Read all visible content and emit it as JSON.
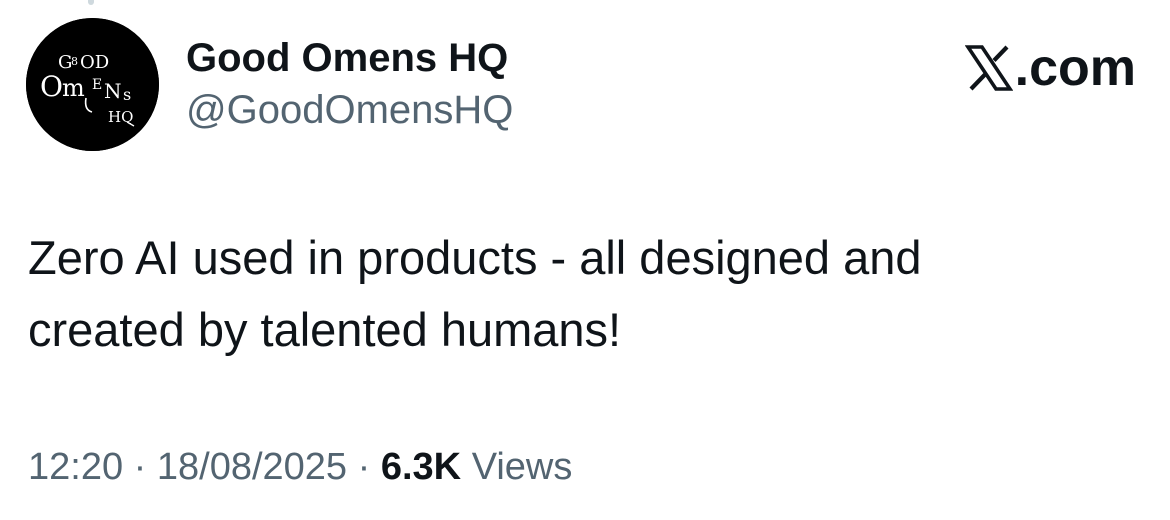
{
  "account": {
    "display_name": "Good Omens HQ",
    "handle": "@GoodOmensHQ",
    "avatar_logo_text": "GOOD OMENS HQ"
  },
  "brand": {
    "label": ".com",
    "icon": "x-logo-icon"
  },
  "tweet": {
    "text_line1": "Zero AI used in products - all designed and",
    "text_line2": "created by talented humans!"
  },
  "meta": {
    "time": "12:20",
    "separator": "·",
    "date": "18/08/2025",
    "views_count": "6.3K",
    "views_label": "Views"
  },
  "colors": {
    "text_primary": "#0f1419",
    "text_secondary": "#536471",
    "avatar_bg": "#000000",
    "avatar_fg": "#ffffff"
  }
}
